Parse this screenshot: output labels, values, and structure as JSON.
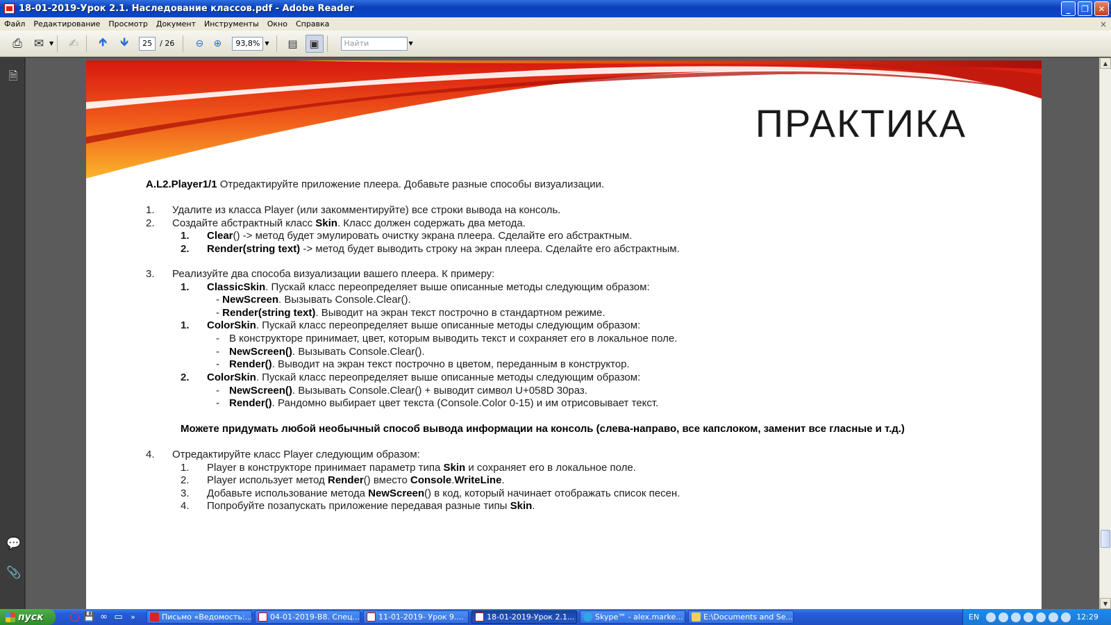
{
  "window": {
    "title": "18-01-2019-Урок 2.1. Наследование классов.pdf - Adobe Reader",
    "buttons": {
      "minimize": "_",
      "maximize": "❐",
      "close": "✕"
    }
  },
  "menu": [
    "Файл",
    "Редактирование",
    "Просмотр",
    "Документ",
    "Инструменты",
    "Окно",
    "Справка"
  ],
  "menu_close": "×",
  "toolbar": {
    "page_current": "25",
    "page_total": "/ 26",
    "zoom": "93,8%",
    "find_placeholder": "Найти"
  },
  "slide": {
    "title": "ПРАКТИКА",
    "task_id": "A.L2.Player1/1",
    "intro": " Отредактируйте приложение плеера. Добавьте разные способы визуализации.",
    "items": {
      "n1": "1.",
      "t1": "Удалите из класса Player (или закомментируйте) все строки вывода на консоль.",
      "n2": "2.",
      "t2a": "Создайте абстрактный класс ",
      "t2b": "Skin",
      "t2c": ". Класс должен содержать два метода.",
      "n2_1": "1.",
      "t2_1a": "Clear",
      "t2_1b": "() -> метод будет эмулировать очистку экрана плеера. Сделайте его абстрактным.",
      "n2_2": "2.",
      "t2_2a": "Render(string text)",
      "t2_2b": " -> метод будет выводить строку на экран плеера. Сделайте его абстрактным.",
      "n3": "3.",
      "t3": "Реализуйте два способа визуализации вашего плеера. К примеру:",
      "n3_1": "1.",
      "t3_1a": "ClassicSkin",
      "t3_1b": ". Пускай класс переопределяет выше описанные методы следующим образом:",
      "t3_1c_pre": "- ",
      "t3_1c_b": "NewScreen",
      "t3_1c": ". Вызывать Console.Clear().",
      "t3_1d_pre": "- ",
      "t3_1d_b": "Render(string text)",
      "t3_1d": ". Выводит на экран текст построчно в стандартном режиме.",
      "n3_2": "1.",
      "t3_2a": "ColorSkin",
      "t3_2b": ". Пускай класс переопределяет выше описанные методы следующим образом:",
      "d1": "-",
      "t3_2c": "В конструкторе принимает, цвет, которым выводить текст и сохраняет его в локальное поле.",
      "d2": "-",
      "t3_2d_b": "NewScreen()",
      "t3_2d": ". Вызывать Console.Clear().",
      "d3": "-",
      "t3_2e_b": "Render()",
      "t3_2e": ". Выводит на экран текст построчно в цветом, переданным в конструктор.",
      "n3_3": "2.",
      "t3_3a": "ColorSkin",
      "t3_3b": ". Пускай класс переопределяет выше описанные методы следующим образом:",
      "d4": "-",
      "t3_3c_b": "NewScreen()",
      "t3_3c": ". Вызывать Console.Clear() + выводит  символ U+058D 30раз.",
      "d5": "-",
      "t3_3d_b": "Render()",
      "t3_3d": ". Рандомно выбирает цвет текста (Console.Color 0-15) и им отрисовывает текст.",
      "bold_note": "Можете придумать любой необычный способ вывода информации на консоль (слева-направо, все капслоком, заменит все гласные и т.д.)",
      "n4": "4.",
      "t4": "Отредактируйте класс Player следующим образом:",
      "n4_1": "1.",
      "t4_1a": "Player в конструкторе принимает параметр типа ",
      "t4_1b": "Skin",
      "t4_1c": " и сохраняет его в локальное поле.",
      "n4_2": "2.",
      "t4_2a": "Player использует метод ",
      "t4_2b": "Render",
      "t4_2c": "() вместо ",
      "t4_2d": "Console",
      "t4_2e": ".",
      "t4_2f": "WriteLine",
      "t4_2g": ".",
      "n4_3": "3.",
      "t4_3a": "Добавьте использование метода ",
      "t4_3b": "NewScreen",
      "t4_3c": "() в код, который начинает отображать список песен.",
      "n4_4": "4.",
      "t4_4a": "Попробуйте позапускать приложение передавая разные типы ",
      "t4_4b": "Skin",
      "t4_4c": "."
    }
  },
  "taskbar": {
    "start": "пуск",
    "quicklaunch_more": "»",
    "tasks": [
      "Письмо «Ведомость:...",
      "04-01-2019-В8. Спец...",
      "11-01-2019- Урок 9....",
      "18-01-2019-Урок 2.1...",
      "Skype™ - alex.marke...",
      "E:\\Documents and Se..."
    ],
    "lang": "EN",
    "clock": "12:29"
  }
}
